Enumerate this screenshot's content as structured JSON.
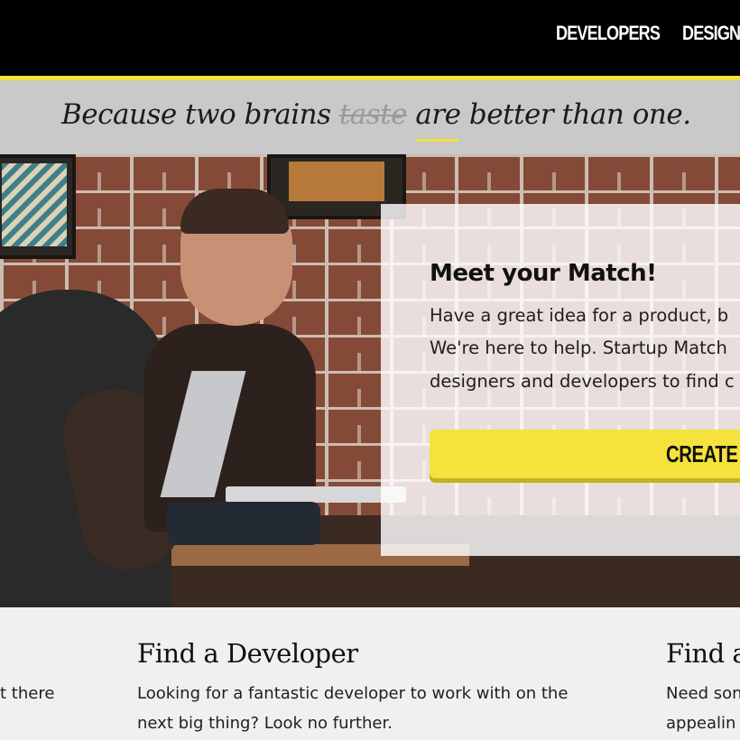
{
  "nav": {
    "items": [
      {
        "label": "DEVELOPERS"
      },
      {
        "label": "DESIGN"
      }
    ]
  },
  "tagline": {
    "before": "Because two brains ",
    "struck": "taste",
    "underlined": "are",
    "after": " better than one."
  },
  "card": {
    "title": "Meet your Match!",
    "lines": [
      "Have a great idea for a product, b",
      "We're here to help. Startup Match",
      "designers and developers to find c"
    ],
    "cta_label": "CREATE A"
  },
  "sections": [
    {
      "title": "",
      "lines": [
        "t there",
        ""
      ]
    },
    {
      "title": "Find a Developer",
      "lines": [
        "Looking for a fantastic developer to work with on the",
        "next big thing? Look no further."
      ]
    },
    {
      "title": "Find a",
      "lines": [
        "Need son",
        "appealin"
      ]
    }
  ],
  "colors": {
    "accent": "#f5e23a",
    "nav_bg": "#000000",
    "tagline_bg": "#c9c9c9"
  }
}
